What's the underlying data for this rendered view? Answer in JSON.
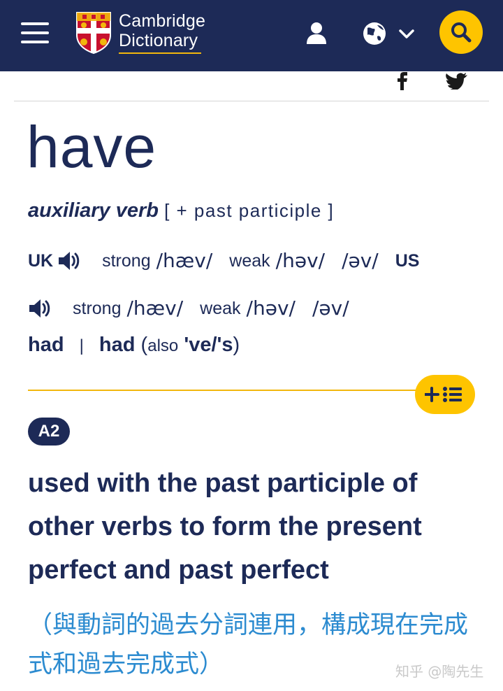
{
  "header": {
    "logo_line1": "Cambridge",
    "logo_line2": "Dictionary",
    "bg_color": "#1d2a57",
    "accent_color": "#fec400"
  },
  "entry": {
    "headword": "have",
    "part_of_speech": "auxiliary verb",
    "grammar": "[ + past participle ]",
    "pron_uk": {
      "region": "UK",
      "strong_label": "strong",
      "strong_ipa": "/hæv/",
      "weak_label": "weak",
      "weak_ipa": "/həv/",
      "weak_ipa2": "/əv/"
    },
    "pron_us": {
      "region": "US",
      "strong_label": "strong",
      "strong_ipa": "/hæv/",
      "weak_label": "weak",
      "weak_ipa": "/həv/",
      "weak_ipa2": "/əv/"
    },
    "forms": {
      "form1": "had",
      "separator": "|",
      "form2": "had",
      "open": "(",
      "also_label": "also",
      "also_forms": "'ve/'s",
      "close": ")"
    },
    "level": "A2",
    "definition": "used with the past participle of other verbs to form the present perfect and past perfect",
    "translation": "（與動詞的過去分詞連用，構成現在完成式和過去完成式）"
  },
  "watermark": "知乎 @陶先生",
  "icons": [
    "menu-icon",
    "cambridge-shield-icon",
    "user-icon",
    "globe-icon",
    "chevron-down-icon",
    "search-icon",
    "facebook-icon",
    "twitter-icon",
    "speaker-icon",
    "add-to-list-icon"
  ]
}
